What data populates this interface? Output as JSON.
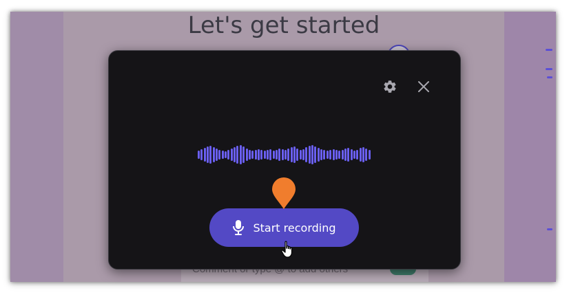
{
  "page": {
    "title": "Let's get started",
    "comment_placeholder": "Comment or type @ to add others"
  },
  "dialog": {
    "settings_icon": "gear-icon",
    "close_icon": "close-icon",
    "record_button": {
      "label": "Start recording",
      "icon": "microphone-icon"
    }
  },
  "overlay": {
    "pin_icon": "location-pin-icon",
    "cursor_icon": "hand-pointer-icon"
  },
  "colors": {
    "dialog_bg": "#151417",
    "accent": "#5349c5",
    "waveform": "#6a5ff1",
    "pin": "#f07d2d",
    "backdrop": "#a08ca8"
  }
}
